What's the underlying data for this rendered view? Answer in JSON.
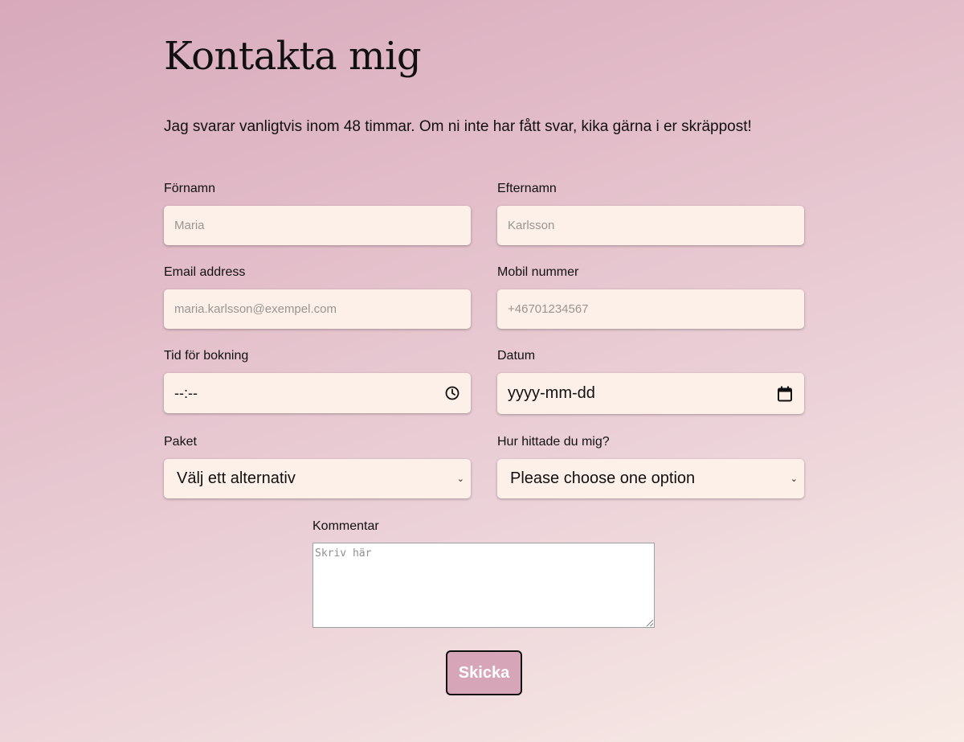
{
  "page": {
    "title": "Kontakta mig",
    "intro": "Jag svarar vanligtvis inom 48 timmar. Om ni inte har fått svar, kika gärna i er skräppost!"
  },
  "form": {
    "first_name": {
      "label": "Förnamn",
      "placeholder": "Maria"
    },
    "last_name": {
      "label": "Efternamn",
      "placeholder": "Karlsson"
    },
    "email": {
      "label": "Email address",
      "placeholder": "maria.karlsson@exempel.com"
    },
    "phone": {
      "label": "Mobil nummer",
      "placeholder": "+46701234567"
    },
    "time": {
      "label": "Tid för bokning",
      "value": "--:--",
      "icon": "clock-icon"
    },
    "date": {
      "label": "Datum",
      "value": "yyyy-mm-dd",
      "icon": "calendar-icon"
    },
    "package": {
      "label": "Paket",
      "selected": "Välj ett alternativ"
    },
    "source": {
      "label": "Hur hittade du mig?",
      "selected": "Please choose one option"
    },
    "comment": {
      "label": "Kommentar",
      "placeholder": "Skriv här"
    },
    "submit_label": "Skicka"
  },
  "colors": {
    "field_bg": "#fdf0e8",
    "button_bg": "#d6a5b8",
    "gradient_start": "#d7a9bb",
    "gradient_end": "#f8ece6"
  }
}
